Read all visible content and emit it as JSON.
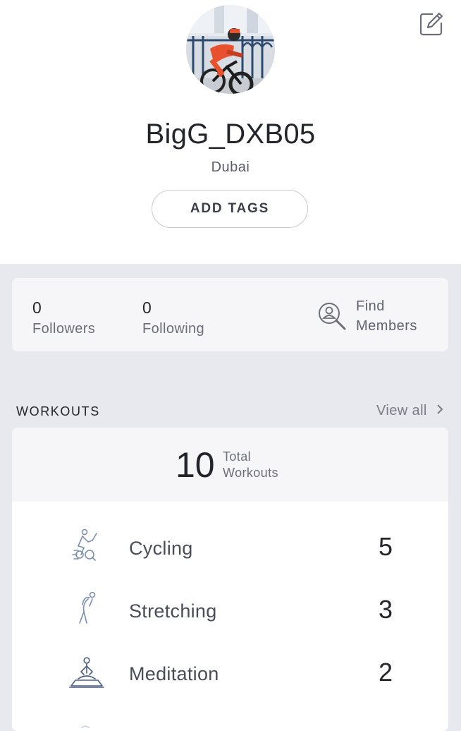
{
  "profile": {
    "username": "BigG_DXB05",
    "location": "Dubai",
    "add_tags_label": "ADD TAGS"
  },
  "social": {
    "followers_count": "0",
    "followers_label": "Followers",
    "following_count": "0",
    "following_label": "Following",
    "find_line1": "Find",
    "find_line2": "Members"
  },
  "workouts": {
    "section_title": "WORKOUTS",
    "view_all_label": "View all",
    "total_count": "10",
    "total_line1": "Total",
    "total_line2": "Workouts",
    "items": [
      {
        "name": "Cycling",
        "count": "5",
        "icon": "cycling-icon"
      },
      {
        "name": "Stretching",
        "count": "3",
        "icon": "stretching-icon"
      },
      {
        "name": "Meditation",
        "count": "2",
        "icon": "meditation-icon"
      }
    ]
  },
  "colors": {
    "background": "#e8e9ee",
    "card": "#ffffff",
    "icon_stroke": "#7b8fb0",
    "text": "#23252b"
  }
}
